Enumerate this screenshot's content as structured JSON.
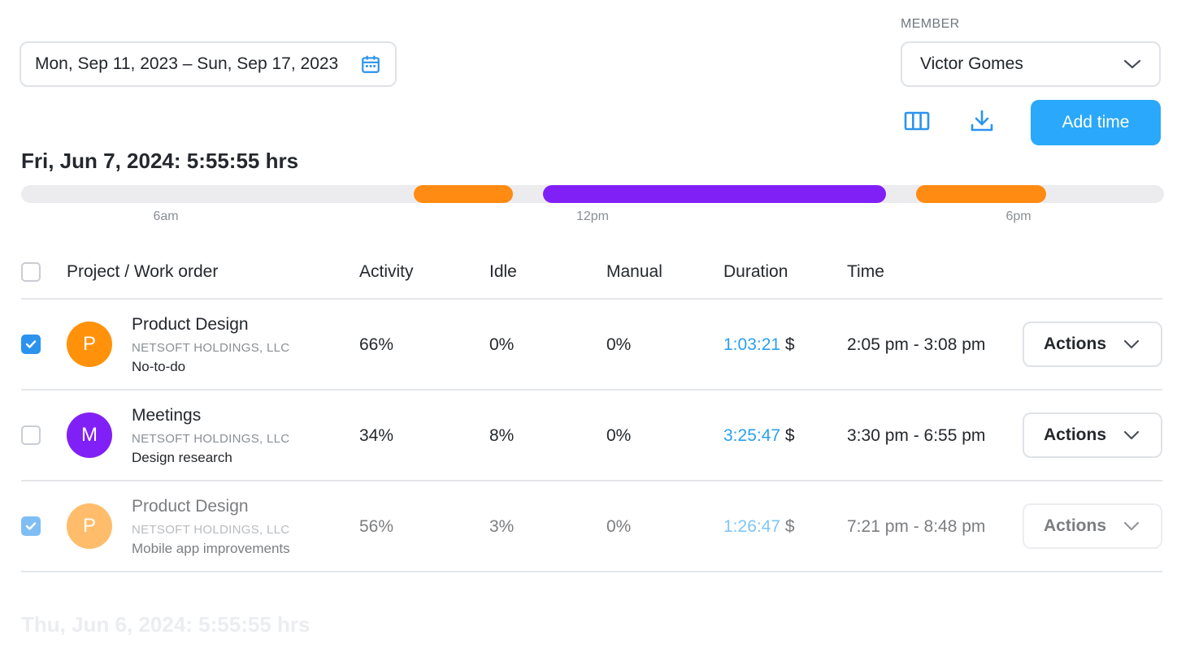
{
  "filters": {
    "date_range": "Mon, Sep 11, 2023 – Sun, Sep 17, 2023",
    "member_label": "MEMBER",
    "member_value": "Victor Gomes"
  },
  "toolbar": {
    "add_time_label": "Add time"
  },
  "day": {
    "title": "Fri, Jun 7, 2024: 5:55:55 hrs",
    "timeline_ticks": [
      "6am",
      "12pm",
      "6pm"
    ]
  },
  "table": {
    "headers": [
      "Project / Work order",
      "Activity",
      "Idle",
      "Manual",
      "Duration",
      "Time"
    ],
    "rows": [
      {
        "checked": true,
        "avatar_letter": "P",
        "avatar_color": "#ff920a",
        "project": "Product Design",
        "client": "NETSOFT HOLDINGS, LLC",
        "task": "No-to-do",
        "activity": "66%",
        "idle": "0%",
        "manual": "0%",
        "duration": "1:03:21",
        "currency": "$",
        "time": "2:05 pm - 3:08 pm",
        "actions_label": "Actions"
      },
      {
        "checked": false,
        "avatar_letter": "M",
        "avatar_color": "#8120f6",
        "project": "Meetings",
        "client": "NETSOFT HOLDINGS, LLC",
        "task": "Design research",
        "activity": "34%",
        "idle": "8%",
        "manual": "0%",
        "duration": "3:25:47",
        "currency": "$",
        "time": "3:30 pm - 6:55 pm",
        "actions_label": "Actions"
      },
      {
        "checked": true,
        "avatar_letter": "P",
        "avatar_color": "#ff920a",
        "project": "Product Design",
        "client": "NETSOFT HOLDINGS, LLC",
        "task": "Mobile app improvements",
        "activity": "56%",
        "idle": "3%",
        "manual": "0%",
        "duration": "1:26:47",
        "currency": "$",
        "time": "7:21 pm - 8:48 pm",
        "actions_label": "Actions"
      }
    ]
  },
  "next_day": {
    "title": "Thu, Jun 6, 2024: 5:55:55 hrs"
  },
  "colors": {
    "accent": "#2aa8fb",
    "activity_orange": "#ff8b12",
    "activity_purple": "#8120f6"
  },
  "icons": {
    "date_picker": "calendar-icon",
    "member_dropdown": "chevron-down-icon",
    "columns": "columns-icon",
    "download": "download-icon",
    "actions_dropdown": "chevron-down-icon"
  }
}
